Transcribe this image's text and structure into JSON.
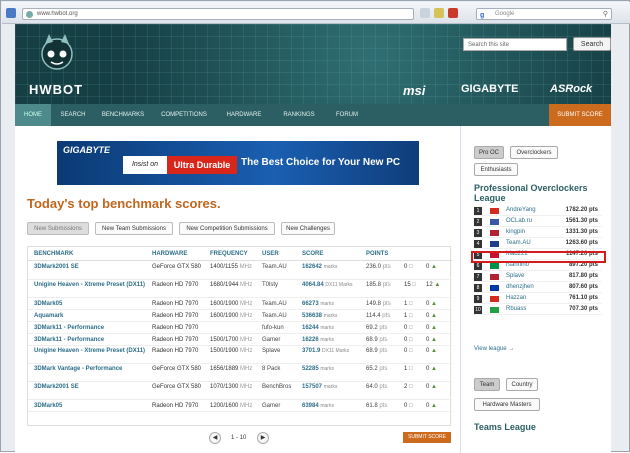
{
  "browser": {
    "url": "www.hwbot.org",
    "search_placeholder": "Google"
  },
  "header": {
    "logo_text": "HWBOT",
    "search_placeholder": "Search this site",
    "search_button": "Search",
    "sponsors": [
      "msi",
      "GIGABYTE",
      "ASRock"
    ]
  },
  "nav": {
    "items": [
      "HOME",
      "SEARCH",
      "BENCHMARKS",
      "COMPETITIONS",
      "HARDWARE",
      "RANKINGS",
      "FORUM"
    ],
    "submit": "SUBMIT SCORE"
  },
  "banner": {
    "brand": "GIGABYTE",
    "insist": "Insist on",
    "ultra": "Ultra Durable",
    "tagline": "The Best Choice for Your New PC"
  },
  "main": {
    "title": "Today's top benchmark scores.",
    "tabs": [
      "New Submissions",
      "New Team Submissions",
      "New Competition Submissions",
      "New Challenges"
    ],
    "columns": [
      "BENCHMARK",
      "HARDWARE",
      "FREQUENCY",
      "USER",
      "SCORE",
      "POINTS"
    ],
    "rows": [
      {
        "bench": "3DMark2001 SE",
        "hw": "GeForce GTX 580",
        "freq": "1400/1155",
        "unit": "MHz",
        "user": "Team.AU",
        "score": "162642",
        "sunit": "marks",
        "pts": "236.0",
        "punit": "pts",
        "cm": "0",
        "lk": "0"
      },
      {
        "bench": "Unigine Heaven - Xtreme Preset (DX11)",
        "hw": "Radeon HD 7970",
        "freq": "1680/1944",
        "unit": "MHz",
        "user": "T0lsty",
        "score": "4064.84",
        "sunit": "DX11 Marks",
        "pts": "185.8",
        "punit": "pts",
        "cm": "15",
        "lk": "12"
      },
      {
        "bench": "3DMark05",
        "hw": "Radeon HD 7970",
        "freq": "1600/1900",
        "unit": "MHz",
        "user": "Team.AU",
        "score": "66273",
        "sunit": "marks",
        "pts": "149.8",
        "punit": "pts",
        "cm": "1",
        "lk": "0"
      },
      {
        "bench": "Aquamark",
        "hw": "Radeon HD 7970",
        "freq": "1600/1900",
        "unit": "MHz",
        "user": "Team.AU",
        "score": "536638",
        "sunit": "marks",
        "pts": "114.4",
        "punit": "pts",
        "cm": "1",
        "lk": "0"
      },
      {
        "bench": "3DMark11 - Performance",
        "hw": "Radeon HD 7970",
        "freq": "",
        "unit": "",
        "user": "fufo-kun",
        "score": "16244",
        "sunit": "marks",
        "pts": "69.2",
        "punit": "pts",
        "cm": "0",
        "lk": "0"
      },
      {
        "bench": "3DMark11 - Performance",
        "hw": "Radeon HD 7970",
        "freq": "1500/1700",
        "unit": "MHz",
        "user": "Gamer",
        "score": "16226",
        "sunit": "marks",
        "pts": "68.9",
        "punit": "pts",
        "cm": "0",
        "lk": "0"
      },
      {
        "bench": "Unigine Heaven - Xtreme Preset (DX11)",
        "hw": "Radeon HD 7970",
        "freq": "1500/1900",
        "unit": "MHz",
        "user": "Splave",
        "score": "3701.9",
        "sunit": "DX11 Marks",
        "pts": "68.9",
        "punit": "pts",
        "cm": "0",
        "lk": "0"
      },
      {
        "bench": "3DMark Vantage - Performance",
        "hw": "GeForce GTX 580",
        "freq": "1656/1889",
        "unit": "MHz",
        "user": "8 Pack",
        "score": "52285",
        "sunit": "marks",
        "pts": "65.2",
        "punit": "pts",
        "cm": "1",
        "lk": "0"
      },
      {
        "bench": "3DMark2001 SE",
        "hw": "GeForce GTX 580",
        "freq": "1070/1300",
        "unit": "MHz",
        "user": "BenchBros",
        "score": "157507",
        "sunit": "marks",
        "pts": "64.0",
        "punit": "pts",
        "cm": "2",
        "lk": "0"
      },
      {
        "bench": "3DMark05",
        "hw": "Radeon HD 7970",
        "freq": "1200/1600",
        "unit": "MHz",
        "user": "Gamer",
        "score": "63984",
        "sunit": "marks",
        "pts": "61.8",
        "punit": "pts",
        "cm": "0",
        "lk": "0"
      }
    ],
    "pager": "1 - 10",
    "submit": "SUBMIT SCORE"
  },
  "side": {
    "tabs1": [
      "Pro OC",
      "Overclockers",
      "Enthusiasts"
    ],
    "pro_title": "Professional Overclockers League",
    "leaders": [
      {
        "rank": "1",
        "name": "AndreYang",
        "pts": "1782.20 pts",
        "flag": "#d52b1e"
      },
      {
        "rank": "2",
        "name": "OCLab.ru",
        "pts": "1561.30 pts",
        "flag": "#3a57a7"
      },
      {
        "rank": "3",
        "name": "kingpin",
        "pts": "1331.30 pts",
        "flag": "#b22234"
      },
      {
        "rank": "4",
        "name": "Team.AU",
        "pts": "1263.60 pts",
        "flag": "#1f3d8a"
      },
      {
        "rank": "5",
        "name": "Mad222",
        "pts": "1147.20 pts",
        "flag": "#c8102e"
      },
      {
        "rank": "6",
        "name": "rsannino",
        "pts": "897.20 pts",
        "flag": "#009246"
      },
      {
        "rank": "7",
        "name": "Splave",
        "pts": "817.80 pts",
        "flag": "#b22234"
      },
      {
        "rank": "8",
        "name": "dhenzjhen",
        "pts": "807.60 pts",
        "flag": "#0038a8"
      },
      {
        "rank": "9",
        "name": "Hazzan",
        "pts": "761.10 pts",
        "flag": "#d52b1e"
      },
      {
        "rank": "10",
        "name": "Rbuass",
        "pts": "707.30 pts",
        "flag": "#229e45"
      }
    ],
    "view_league": "View league →",
    "tabs2": [
      "Team",
      "Country",
      "Hardware Masters"
    ],
    "teams_title": "Teams League"
  }
}
